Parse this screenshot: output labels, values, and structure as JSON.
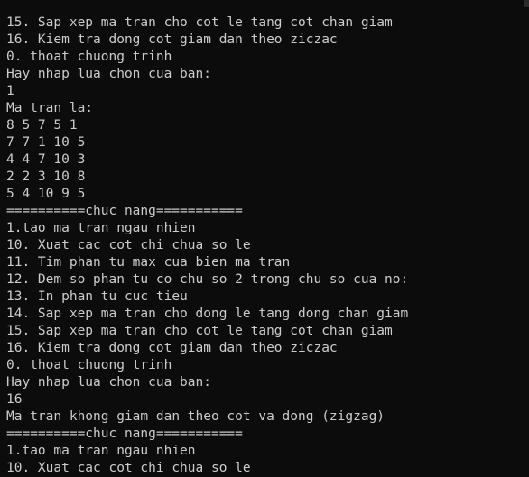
{
  "terminal": {
    "lines": [
      "15. Sap xep ma tran cho cot le tang cot chan giam",
      "16. Kiem tra dong cot giam dan theo ziczac",
      "0. thoat chuong trinh",
      "Hay nhap lua chon cua ban:",
      "1",
      "Ma tran la:",
      "8 5 7 5 1",
      "7 7 1 10 5",
      "4 4 7 10 3",
      "2 2 3 10 8",
      "5 4 10 9 5",
      "==========chuc nang===========",
      "1.tao ma tran ngau nhien",
      "10. Xuat cac cot chi chua so le",
      "11. Tim phan tu max cua bien ma tran",
      "12. Dem so phan tu co chu so 2 trong chu so cua no:",
      "13. In phan tu cuc tieu",
      "14. Sap xep ma tran cho dong le tang dong chan giam",
      "15. Sap xep ma tran cho cot le tang cot chan giam",
      "16. Kiem tra dong cot giam dan theo ziczac",
      "0. thoat chuong trinh",
      "Hay nhap lua chon cua ban:",
      "16",
      "Ma tran khong giam dan theo cot va dong (zigzag)",
      "==========chuc nang===========",
      "1.tao ma tran ngau nhien",
      "10. Xuat cac cot chi chua so le"
    ]
  },
  "colors": {
    "background": "#0c0c0c",
    "text": "#cccccc"
  }
}
